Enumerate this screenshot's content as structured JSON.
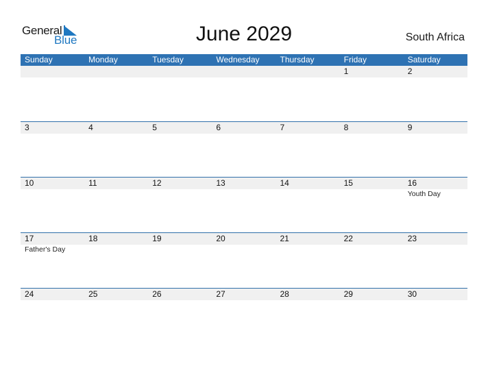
{
  "logo": {
    "line1": "General",
    "line2": "Blue",
    "accent_color": "#1f78c1"
  },
  "header": {
    "title": "June 2029",
    "country": "South Africa"
  },
  "calendar": {
    "header_color": "#2e72b3",
    "weekdays": [
      "Sunday",
      "Monday",
      "Tuesday",
      "Wednesday",
      "Thursday",
      "Friday",
      "Saturday"
    ],
    "weeks": [
      [
        {
          "day": ""
        },
        {
          "day": ""
        },
        {
          "day": ""
        },
        {
          "day": ""
        },
        {
          "day": ""
        },
        {
          "day": "1"
        },
        {
          "day": "2"
        }
      ],
      [
        {
          "day": "3"
        },
        {
          "day": "4"
        },
        {
          "day": "5"
        },
        {
          "day": "6"
        },
        {
          "day": "7"
        },
        {
          "day": "8"
        },
        {
          "day": "9"
        }
      ],
      [
        {
          "day": "10"
        },
        {
          "day": "11"
        },
        {
          "day": "12"
        },
        {
          "day": "13"
        },
        {
          "day": "14"
        },
        {
          "day": "15"
        },
        {
          "day": "16",
          "holiday": "Youth Day"
        }
      ],
      [
        {
          "day": "17",
          "holiday": "Father's Day"
        },
        {
          "day": "18"
        },
        {
          "day": "19"
        },
        {
          "day": "20"
        },
        {
          "day": "21"
        },
        {
          "day": "22"
        },
        {
          "day": "23"
        }
      ],
      [
        {
          "day": "24"
        },
        {
          "day": "25"
        },
        {
          "day": "26"
        },
        {
          "day": "27"
        },
        {
          "day": "28"
        },
        {
          "day": "29"
        },
        {
          "day": "30"
        }
      ]
    ]
  }
}
